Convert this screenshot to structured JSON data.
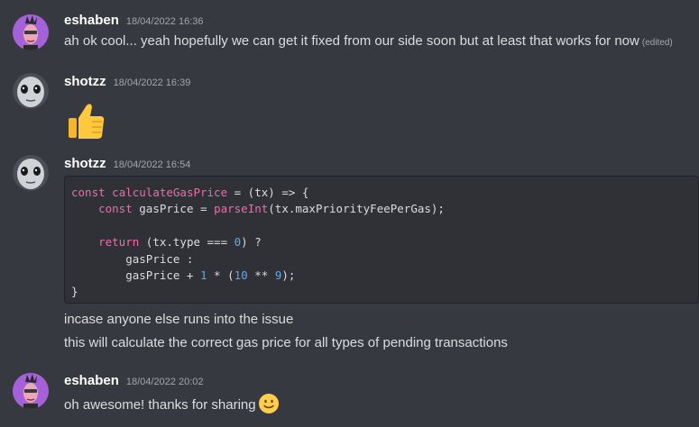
{
  "messages": [
    {
      "username": "eshaben",
      "timestamp": "18/04/2022 16:36",
      "lines": [
        "ah ok cool... yeah hopefully we can get it fixed from our side soon but at least that works for now"
      ],
      "edited_label": "(edited)"
    },
    {
      "username": "shotzz",
      "timestamp": "18/04/2022 16:39",
      "emoji": "thumbs-up"
    },
    {
      "username": "shotzz",
      "timestamp": "18/04/2022 16:54",
      "code": [
        "const calculateGasPrice = (tx) => {",
        "    const gasPrice = parseInt(tx.maxPriorityFeePerGas);",
        "",
        "    return (tx.type === 0) ?",
        "        gasPrice :",
        "        gasPrice + 1 * (10 ** 9);",
        "}"
      ],
      "lines": [
        "incase anyone else runs into the issue",
        "this will calculate the correct gas price for all types of pending transactions"
      ]
    },
    {
      "username": "eshaben",
      "timestamp": "18/04/2022 20:02",
      "lines": [
        "oh awesome! thanks for sharing"
      ],
      "emoji": "slightly-smiling-face"
    }
  ],
  "colors": {
    "background": "#36393f",
    "codeblock_bg": "#2f3136",
    "keyword": "#ec6dab",
    "number": "#63a7e5",
    "username": "#ffffff",
    "timestamp": "#a3a6aa"
  }
}
